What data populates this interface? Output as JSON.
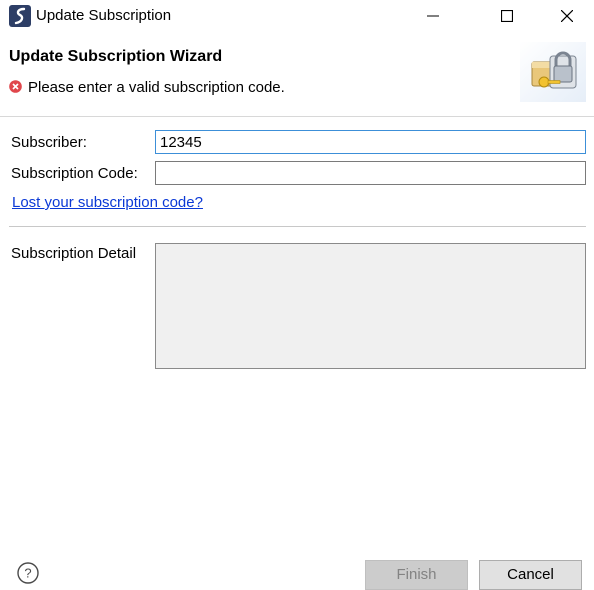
{
  "window": {
    "title": "Update Subscription",
    "buttons": {
      "minimize_icon": "minimize-icon",
      "maximize_icon": "maximize-icon",
      "close_icon": "close-icon"
    }
  },
  "header": {
    "title": "Update Subscription Wizard",
    "error_message": "Please enter a valid subscription code.",
    "error_icon": "error-icon",
    "banner_icon": "lock-key-icon"
  },
  "form": {
    "subscriber_label": "Subscriber:",
    "subscriber_value": "12345",
    "code_label": "Subscription Code:",
    "code_value": "",
    "lost_link": "Lost your subscription code?",
    "detail_label": "Subscription Detail"
  },
  "footer": {
    "help_icon": "help-icon",
    "finish_label": "Finish",
    "cancel_label": "Cancel"
  },
  "colors": {
    "link": "#0b39d6",
    "focus_border": "#3c8fd8",
    "error": "#e0474c"
  }
}
